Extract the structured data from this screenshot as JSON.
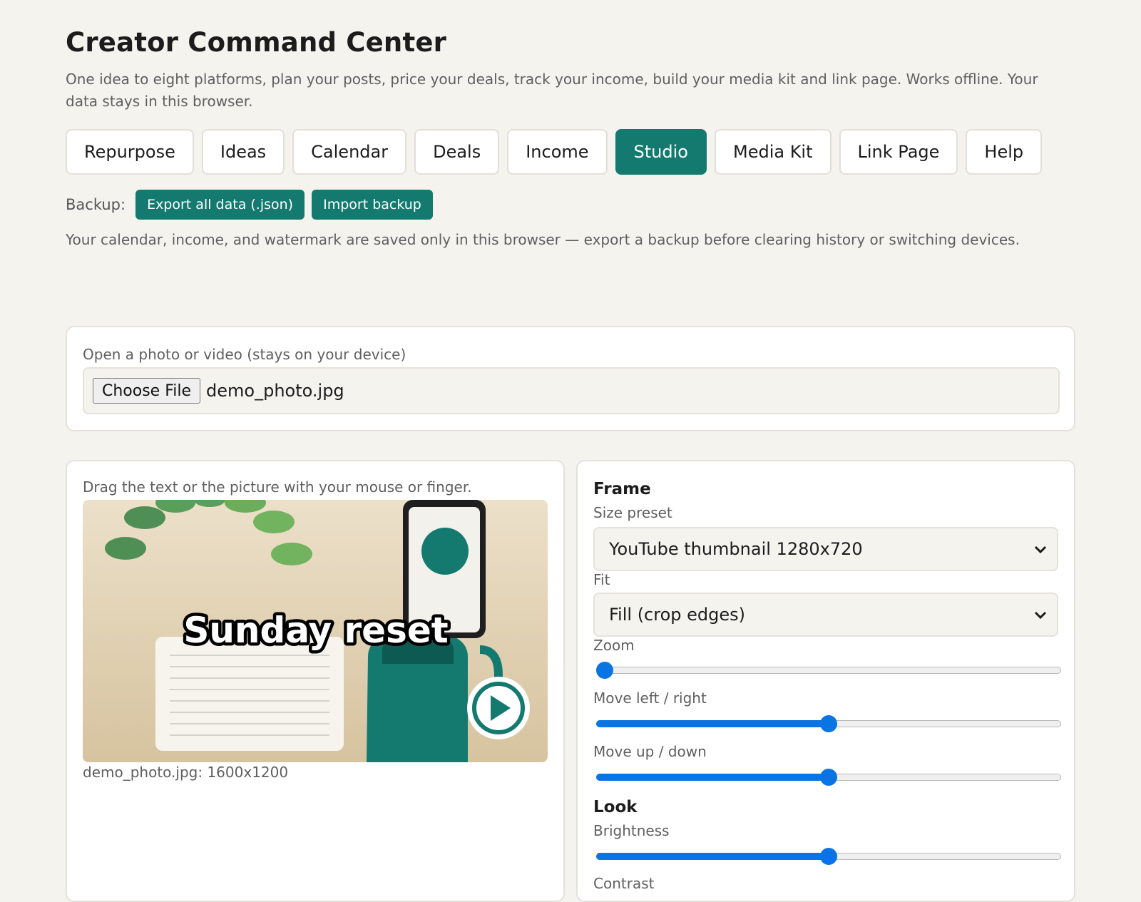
{
  "header": {
    "title": "Creator Command Center",
    "subtitle": "One idea to eight platforms, plan your posts, price your deals, track your income, build your media kit and link page. Works offline. Your data stays in this browser."
  },
  "tabs": [
    {
      "label": "Repurpose",
      "active": false
    },
    {
      "label": "Ideas",
      "active": false
    },
    {
      "label": "Calendar",
      "active": false
    },
    {
      "label": "Deals",
      "active": false
    },
    {
      "label": "Income",
      "active": false
    },
    {
      "label": "Studio",
      "active": true
    },
    {
      "label": "Media Kit",
      "active": false
    },
    {
      "label": "Link Page",
      "active": false
    },
    {
      "label": "Help",
      "active": false
    }
  ],
  "backup": {
    "label": "Backup:",
    "export_label": "Export all data (.json)",
    "import_label": "Import backup",
    "note": "Your calendar, income, and watermark are saved only in this browser — export a backup before clearing history or switching devices."
  },
  "upload": {
    "label": "Open a photo or video (stays on your device)",
    "choose_label": "Choose File",
    "file_name": "demo_photo.jpg"
  },
  "preview": {
    "hint": "Drag the text or the picture with your mouse or finger.",
    "overlay_text": "Sunday reset",
    "caption": "demo_photo.jpg: 1600x1200"
  },
  "controls": {
    "frame_heading": "Frame",
    "size_preset_label": "Size preset",
    "size_preset_value": "YouTube thumbnail 1280x720",
    "fit_label": "Fit",
    "fit_value": "Fill (crop edges)",
    "zoom_label": "Zoom",
    "zoom_value": 0.0,
    "move_lr_label": "Move left / right",
    "move_lr_value": 0.5,
    "move_ud_label": "Move up / down",
    "move_ud_value": 0.5,
    "look_heading": "Look",
    "brightness_label": "Brightness",
    "brightness_value": 0.5,
    "contrast_label": "Contrast"
  },
  "colors": {
    "accent": "#147a6f",
    "background": "#f5f3ee",
    "slider": "#0b74e5"
  }
}
